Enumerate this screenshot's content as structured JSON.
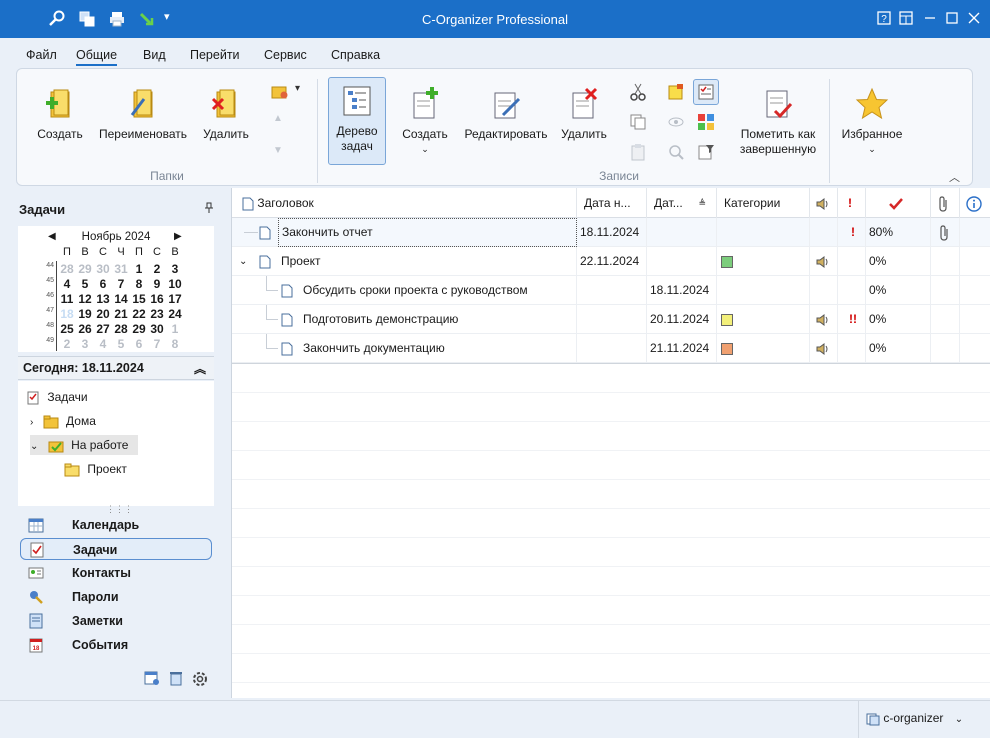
{
  "app": {
    "title": "C-Organizer Professional"
  },
  "menu": [
    "Файл",
    "Общие",
    "Вид",
    "Перейти",
    "Сервис",
    "Справка"
  ],
  "ribbon": {
    "folders": {
      "create": "Создать",
      "rename": "Переименовать",
      "delete": "Удалить",
      "group": "Папки"
    },
    "records": {
      "tree": "Дерево задач",
      "create": "Создать",
      "edit": "Редактировать",
      "delete": "Удалить",
      "mark_done": "Пометить как завершенную",
      "favorites": "Избранное",
      "group": "Записи"
    }
  },
  "left": {
    "title": "Задачи",
    "calendar": {
      "month": "Ноябрь 2024",
      "weekdays": [
        "П",
        "В",
        "С",
        "Ч",
        "П",
        "С",
        "В"
      ],
      "weeks": [
        {
          "num": "44",
          "days": [
            "28",
            "29",
            "30",
            "31",
            "1",
            "2",
            "3"
          ]
        },
        {
          "num": "45",
          "days": [
            "4",
            "5",
            "6",
            "7",
            "8",
            "9",
            "10"
          ]
        },
        {
          "num": "46",
          "days": [
            "11",
            "12",
            "13",
            "14",
            "15",
            "16",
            "17"
          ]
        },
        {
          "num": "47",
          "days": [
            "18",
            "19",
            "20",
            "21",
            "22",
            "23",
            "24"
          ]
        },
        {
          "num": "48",
          "days": [
            "25",
            "26",
            "27",
            "28",
            "29",
            "30",
            "1"
          ]
        },
        {
          "num": "49",
          "days": [
            "2",
            "3",
            "4",
            "5",
            "6",
            "7",
            "8"
          ]
        }
      ]
    },
    "today": "Сегодня: 18.11.2024",
    "tree": {
      "root": "Задачи",
      "home": "Дома",
      "work": "На работе",
      "project": "Проект"
    },
    "nav": [
      "Календарь",
      "Задачи",
      "Контакты",
      "Пароли",
      "Заметки",
      "События"
    ]
  },
  "grid": {
    "headers": {
      "title": "Заголовок",
      "date_start": "Дата н...",
      "date_due": "Дат...",
      "categories": "Категории"
    },
    "rows": [
      {
        "title": "Закончить отчет",
        "start": "18.11.2024",
        "due": "",
        "category_color": "",
        "sound": false,
        "priority": "!",
        "progress": "80%",
        "attach": true
      },
      {
        "title": "Проект",
        "start": "22.11.2024",
        "due": "",
        "category_color": "#7ccd7c",
        "sound": true,
        "priority": "",
        "progress": "0%",
        "attach": false
      },
      {
        "title": "Обсудить сроки проекта с руководством",
        "start": "",
        "due": "18.11.2024",
        "category_color": "",
        "sound": false,
        "priority": "",
        "progress": "0%",
        "attach": false
      },
      {
        "title": "Подготовить демонстрацию",
        "start": "",
        "due": "20.11.2024",
        "category_color": "#f3f07a",
        "sound": true,
        "priority": "!!",
        "progress": "0%",
        "attach": false
      },
      {
        "title": "Закончить документацию",
        "start": "",
        "due": "21.11.2024",
        "category_color": "#f0a070",
        "sound": true,
        "priority": "",
        "progress": "0%",
        "attach": false
      }
    ]
  },
  "status": {
    "profile": "c-organizer"
  },
  "colors": {
    "accent": "#1b6fc8",
    "priority": "#d00000"
  }
}
